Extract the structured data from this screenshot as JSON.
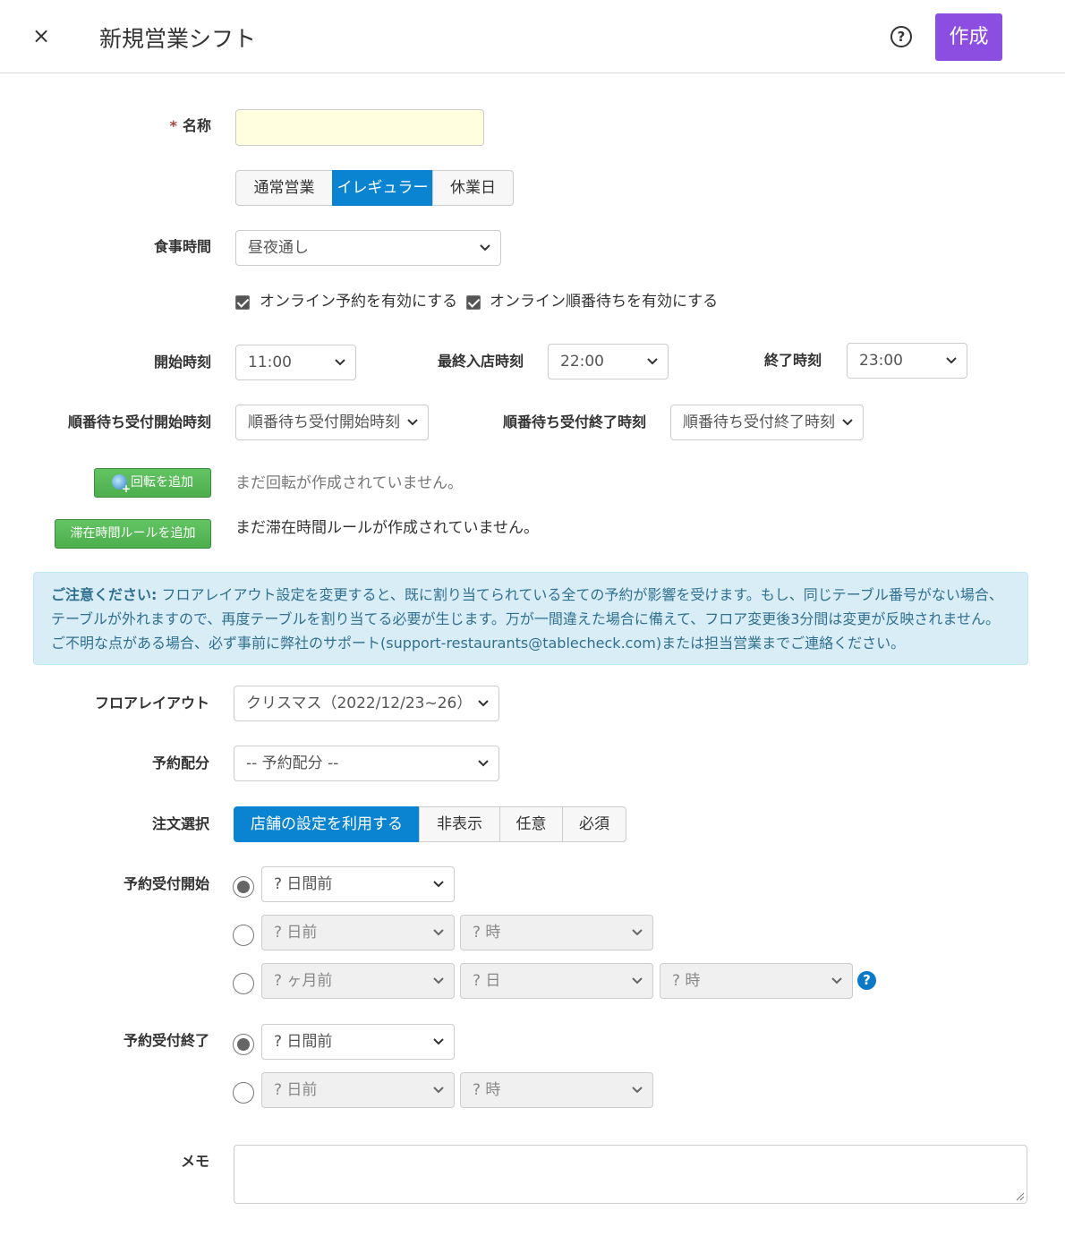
{
  "header": {
    "title": "新規営業シフト",
    "create_label": "作成",
    "help_glyph": "?",
    "close_glyph": "×"
  },
  "form": {
    "name_label": "名称",
    "required_mark": "*",
    "shift_types": [
      "通常営業",
      "イレギュラー",
      "休業日"
    ],
    "shift_type_selected": "イレギュラー",
    "meal_time_label": "食事時間",
    "meal_time_value": "昼夜通し",
    "online_reservation_label": "オンライン予約を有効にする",
    "online_queue_label": "オンライン順番待ちを有効にする",
    "start_time_label": "開始時刻",
    "start_time_value": "11:00",
    "last_entry_label": "最終入店時刻",
    "last_entry_value": "22:00",
    "end_time_label": "終了時刻",
    "end_time_value": "23:00",
    "queue_start_label": "順番待ち受付開始時刻",
    "queue_start_placeholder": "順番待ち受付開始時刻",
    "queue_end_label": "順番待ち受付終了時刻",
    "queue_end_placeholder": "順番待ち受付終了時刻",
    "add_turn_label": "回転を追加",
    "no_turn_text": "まだ回転が作成されていません。",
    "add_stay_rule_label": "滞在時間ルールを追加",
    "no_stay_rule_text": "まだ滞在時間ルールが作成されていません。"
  },
  "alert": {
    "heading": "ご注意ください:",
    "body": "フロアレイアウト設定を変更すると、既に割り当てられている全ての予約が影響を受けます。もし、同じテーブル番号がない場合、テーブルが外れますので、再度テーブルを割り当てる必要が生じます。万が一間違えた場合に備えて、フロア変更後3分間は変更が反映されません。ご不明な点がある場合、必ず事前に弊社のサポート(support-restaurants@tablecheck.com)または担当営業までご連絡ください。"
  },
  "floor": {
    "label": "フロアレイアウト",
    "value": "クリスマス（2022/12/23~26）"
  },
  "allocation": {
    "label": "予約配分",
    "value": "-- 予約配分 --"
  },
  "order": {
    "label": "注文選択",
    "options": [
      "店舗の設定を利用する",
      "非表示",
      "任意",
      "必須"
    ],
    "selected": "店舗の設定を利用する"
  },
  "booking_start": {
    "label": "予約受付開始",
    "row1": [
      "? 日間前"
    ],
    "row2": [
      "? 日前",
      "? 時"
    ],
    "row3": [
      "? ヶ月前",
      "? 日",
      "? 時"
    ],
    "selected_row": 1
  },
  "booking_end": {
    "label": "予約受付終了",
    "row1": [
      "? 日間前"
    ],
    "row2": [
      "? 日前",
      "? 時"
    ],
    "selected_row": 1
  },
  "memo": {
    "label": "メモ",
    "value": ""
  },
  "colors": {
    "create_button": "#8c4ee0",
    "active_segment": "#0a84d0",
    "green_button": "#4cae4c",
    "alert_bg": "#d9edf7",
    "alert_text": "#31708f",
    "name_input_bg": "#ffffe0"
  }
}
